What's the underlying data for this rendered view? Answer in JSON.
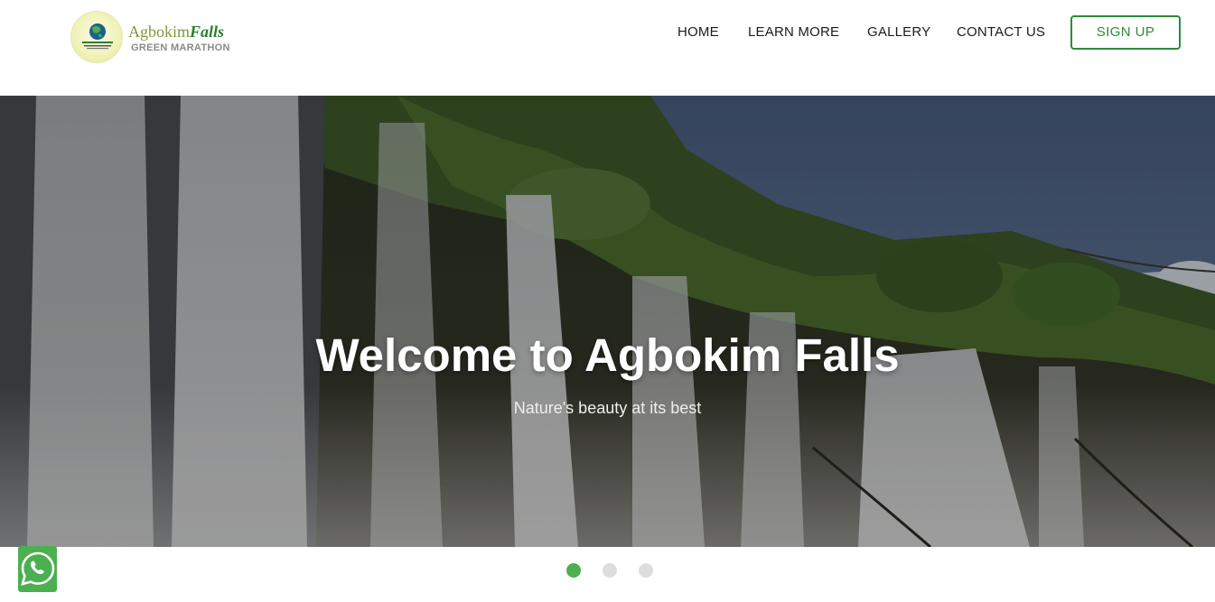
{
  "brand": {
    "name_part1": "Agbokim",
    "name_part2": "Falls",
    "tagline": "GREEN MARATHON",
    "badge_text": "AGBOKIM FALLS"
  },
  "nav": {
    "home": "HOME",
    "learn_more": "LEARN MORE",
    "gallery": "GALLERY",
    "contact_us": "CONTACT US",
    "sign_up": "SIGN UP"
  },
  "hero": {
    "title": "Welcome to Agbokim Falls",
    "subtitle": "Nature's beauty at its best"
  },
  "carousel": {
    "slide_count": 3,
    "active_index": 0
  },
  "colors": {
    "accent": "#2e8b3a",
    "dot_active": "#4caf50",
    "dot_inactive": "#dddddd",
    "whatsapp": "#4caf50"
  },
  "icons": {
    "chat": "whatsapp-icon"
  }
}
